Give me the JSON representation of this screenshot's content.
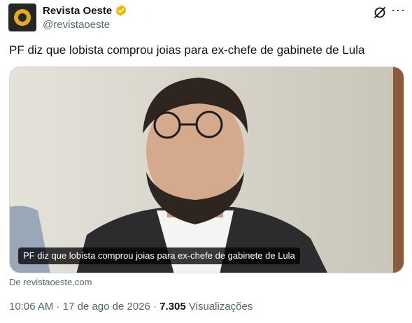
{
  "author": {
    "name": "Revista Oeste",
    "handle": "@revistaoeste",
    "verified_color": "#f4b400"
  },
  "actions": {
    "grok_icon": "grok-icon",
    "more_label": "···"
  },
  "tweet": {
    "text": "PF diz que lobista comprou joias para ex-chefe de gabinete de Lula"
  },
  "card": {
    "caption": "PF diz que lobista comprou joias para ex-chefe de gabinete de Lula",
    "source": "De revistaoeste.com"
  },
  "meta": {
    "time": "10:06 AM",
    "sep1": " · ",
    "date": "17 de ago de 2026",
    "sep2": " · ",
    "views_count": "7.305",
    "views_label": " Visualizações"
  }
}
